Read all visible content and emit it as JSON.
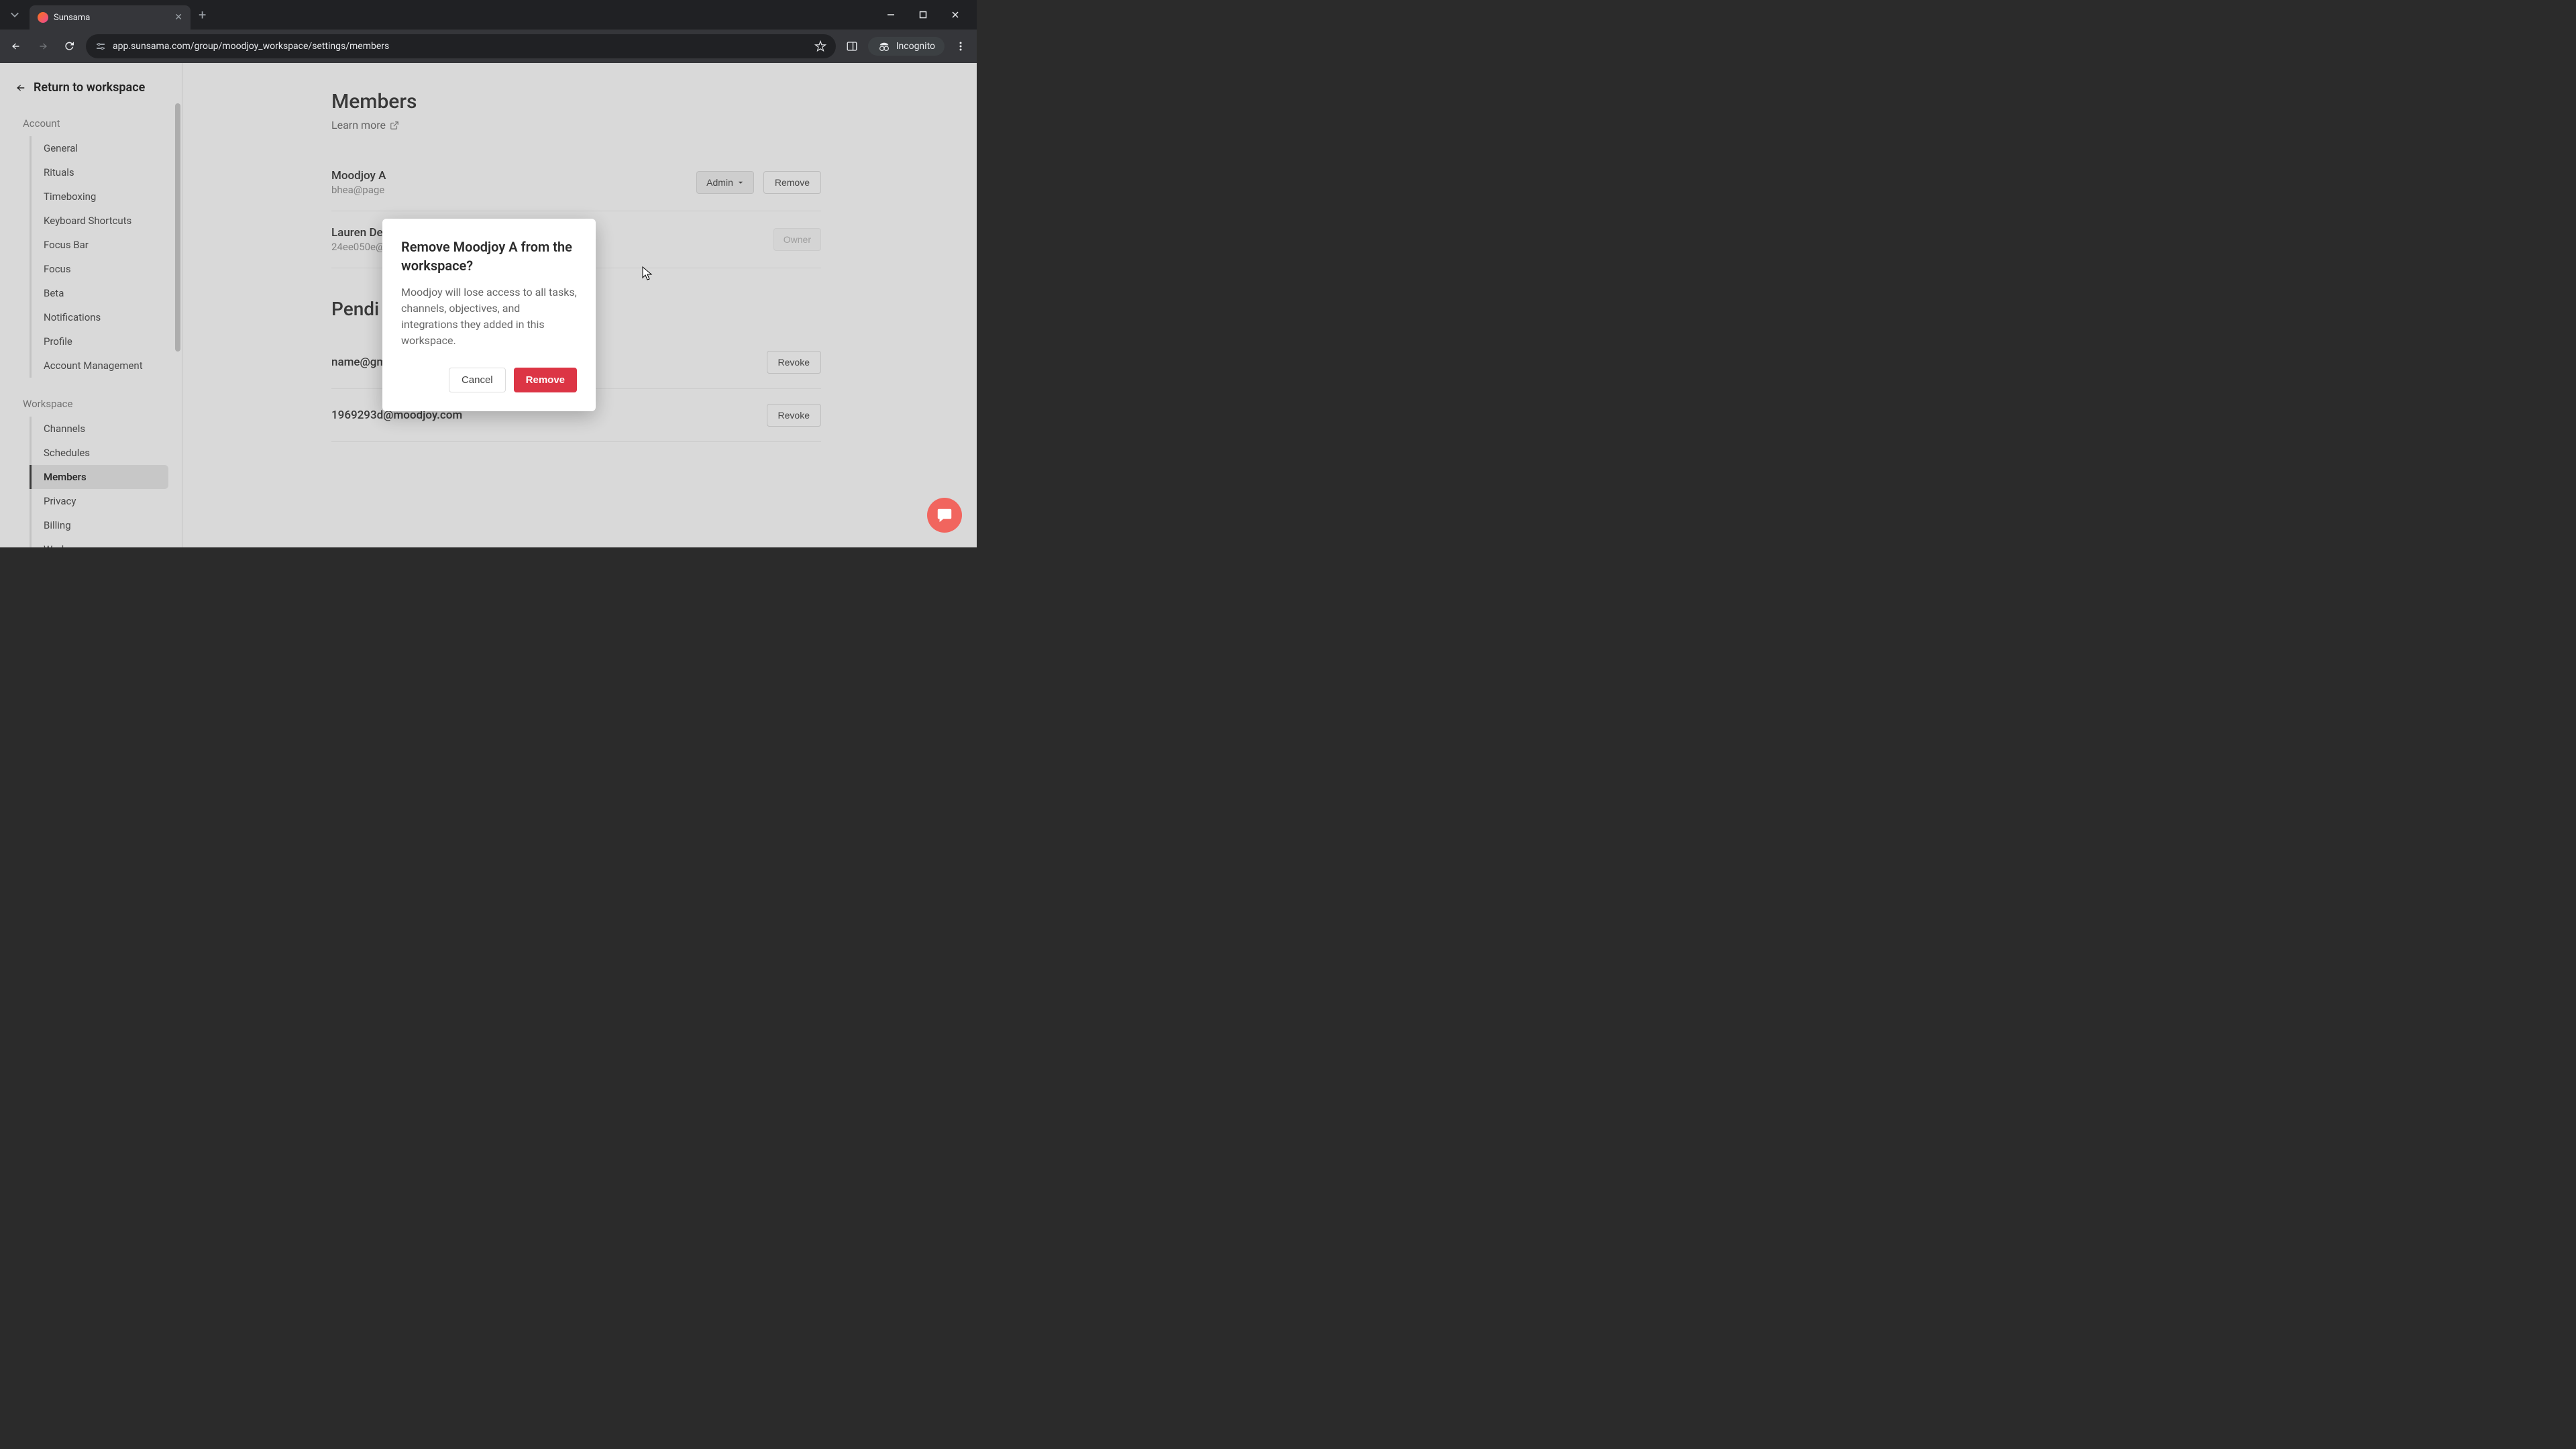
{
  "browser": {
    "tab_title": "Sunsama",
    "url": "app.sunsama.com/group/moodjoy_workspace/settings/members",
    "incognito_label": "Incognito"
  },
  "sidebar": {
    "return_label": "Return to workspace",
    "sections": {
      "account": {
        "label": "Account",
        "items": [
          "General",
          "Rituals",
          "Timeboxing",
          "Keyboard Shortcuts",
          "Focus Bar",
          "Focus",
          "Beta",
          "Notifications",
          "Profile",
          "Account Management"
        ]
      },
      "workspace": {
        "label": "Workspace",
        "items": [
          "Channels",
          "Schedules",
          "Members",
          "Privacy",
          "Billing",
          "Workspace"
        ]
      }
    }
  },
  "page": {
    "title": "Members",
    "learn_more": "Learn more",
    "members": [
      {
        "name": "Moodjoy A",
        "email": "bhea@page",
        "role": "Admin",
        "action": "Remove"
      },
      {
        "name": "Lauren De",
        "email": "24ee050e@",
        "role": "Owner",
        "action": ""
      }
    ],
    "pending_title": "Pendi",
    "pending": [
      {
        "email": "name@gmail.com",
        "action": "Revoke"
      },
      {
        "email": "1969293d@moodjoy.com",
        "action": "Revoke"
      }
    ]
  },
  "modal": {
    "title": "Remove Moodjoy A from the workspace?",
    "body": "Moodjoy will lose access to all tasks, channels, objectives, and integrations they added in this workspace.",
    "cancel": "Cancel",
    "confirm": "Remove"
  }
}
